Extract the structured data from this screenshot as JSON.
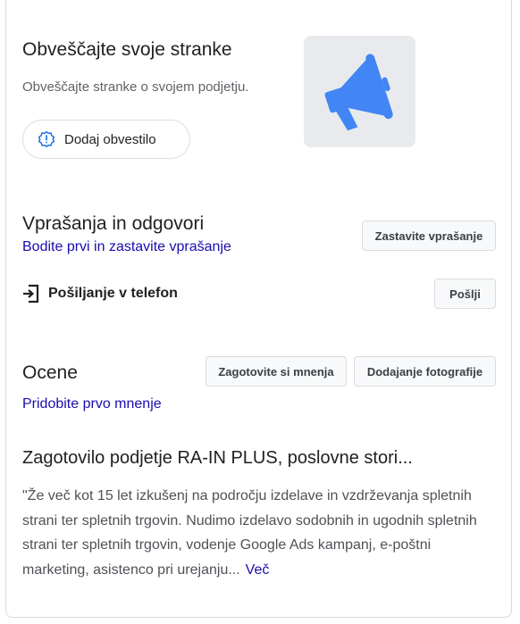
{
  "announce": {
    "title": "Obveščajte svoje stranke",
    "subtitle": "Obveščajte stranke o svojem podjetju.",
    "button_label": "Dodaj obvestilo",
    "button_icon": "alert-circle-icon",
    "illustration_icon": "megaphone-icon",
    "accent_color": "#4285f4"
  },
  "qa": {
    "title": "Vprašanja in odgovori",
    "link": "Bodite prvi in zastavite vprašanje",
    "ask_button": "Zastavite vprašanje"
  },
  "send": {
    "label": "Pošiljanje v telefon",
    "icon": "send-to-phone-icon",
    "button": "Pošlji"
  },
  "reviews": {
    "title": "Ocene",
    "write_button": "Zagotovite si mnenja",
    "photo_button": "Dodajanje fotografije",
    "link": "Pridobite prvo mnenje"
  },
  "from_business": {
    "title": "Zagotovilo podjetje RA-IN PLUS, poslovne stori...",
    "description": "\"Že več kot 15 let izkušenj na področju izdelave in vzdrževanja spletnih strani ter spletnih trgovin. Nudimo izdelavo sodobnih in ugodnih spletnih strani ter spletnih trgovin, vodenje Google Ads kampanj, e-poštni marketing, asistenco pri urejanju...",
    "more": "Več"
  }
}
